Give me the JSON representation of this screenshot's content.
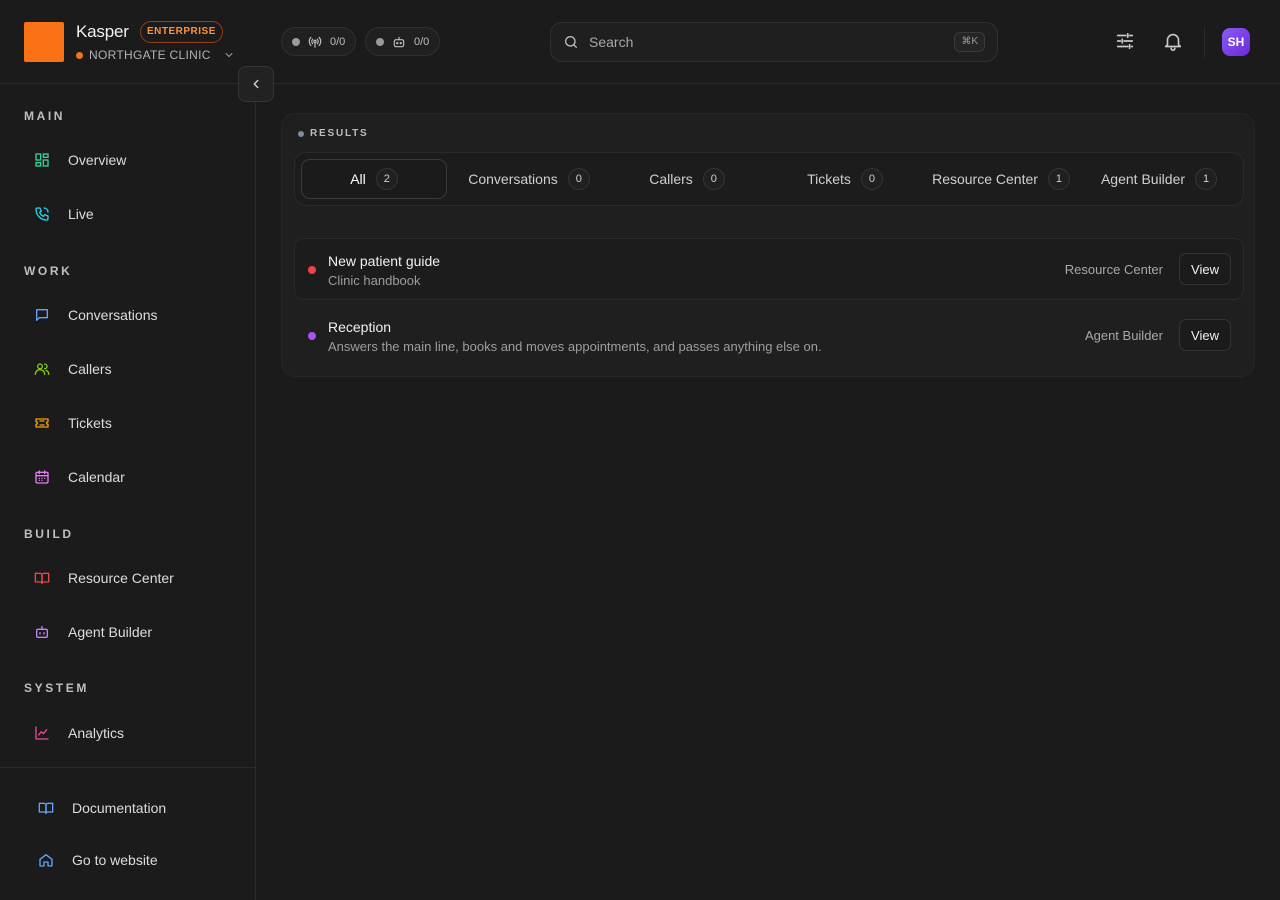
{
  "brand": {
    "name": "Kasper",
    "badge": "ENTERPRISE",
    "org": "NORTHGATE CLINIC"
  },
  "status": [
    {
      "icon": "antenna-icon",
      "value": "0/0"
    },
    {
      "icon": "bot-icon",
      "value": "0/0"
    }
  ],
  "search": {
    "placeholder": "Search",
    "shortcut": "⌘K"
  },
  "user": {
    "initials": "SH"
  },
  "sidebar": {
    "sections": [
      "MAIN",
      "WORK",
      "BUILD",
      "SYSTEM"
    ],
    "items": [
      {
        "label": "Overview",
        "icon": "dashboard-icon",
        "color": "#34d399"
      },
      {
        "label": "Live",
        "icon": "phone-icon",
        "color": "#22d3ee"
      },
      {
        "label": "Conversations",
        "icon": "message-icon",
        "color": "#60a5fa"
      },
      {
        "label": "Callers",
        "icon": "users-icon",
        "color": "#84cc16"
      },
      {
        "label": "Tickets",
        "icon": "ticket-icon",
        "color": "#f59e0b"
      },
      {
        "label": "Calendar",
        "icon": "calendar-icon",
        "color": "#e879f9"
      },
      {
        "label": "Resource Center",
        "icon": "book-icon",
        "color": "#ef4444"
      },
      {
        "label": "Agent Builder",
        "icon": "bot-icon",
        "color": "#c084fc"
      },
      {
        "label": "Analytics",
        "icon": "chart-icon",
        "color": "#ec4899"
      }
    ],
    "footer": [
      {
        "label": "Documentation",
        "icon": "book-open-icon",
        "color": "#60a5fa"
      },
      {
        "label": "Go to website",
        "icon": "home-icon",
        "color": "#60a5fa"
      }
    ]
  },
  "results": {
    "label": "RESULTS",
    "tabs": [
      {
        "label": "All",
        "count": "2",
        "active": true
      },
      {
        "label": "Conversations",
        "count": "0"
      },
      {
        "label": "Callers",
        "count": "0"
      },
      {
        "label": "Tickets",
        "count": "0"
      },
      {
        "label": "Resource Center",
        "count": "1"
      },
      {
        "label": "Agent Builder",
        "count": "1"
      }
    ],
    "items": [
      {
        "title": "New patient guide",
        "subtitle": "Clinic handbook",
        "source": "Resource Center",
        "action": "View",
        "color": "#ef4444"
      },
      {
        "title": "Reception",
        "subtitle": "Answers the main line, books and moves appointments, and passes anything else on.",
        "source": "Agent Builder",
        "action": "View",
        "color": "#a855f7"
      }
    ]
  }
}
